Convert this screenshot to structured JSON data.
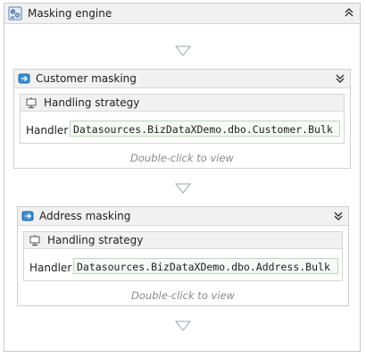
{
  "outer": {
    "title": "Masking engine",
    "icon": "masking-engine-icon",
    "collapse_icon": "chevron-double-up-icon"
  },
  "connector_icon": "down-triangle-icon",
  "activities": [
    {
      "title": "Customer masking",
      "icon": "masking-activity-icon",
      "expand_icon": "chevron-double-down-icon",
      "strategy_title": "Handling strategy",
      "strategy_icon": "handling-strategy-icon",
      "handler_label": "Handler",
      "handler_value": "Datasources.BizDataXDemo.dbo.Customer.Bulk",
      "hint": "Double-click to view"
    },
    {
      "title": "Address masking",
      "icon": "masking-activity-icon",
      "expand_icon": "chevron-double-down-icon",
      "strategy_title": "Handling strategy",
      "strategy_icon": "handling-strategy-icon",
      "handler_label": "Handler",
      "handler_value": "Datasources.BizDataXDemo.dbo.Address.Bulk",
      "hint": "Double-click to view"
    }
  ]
}
